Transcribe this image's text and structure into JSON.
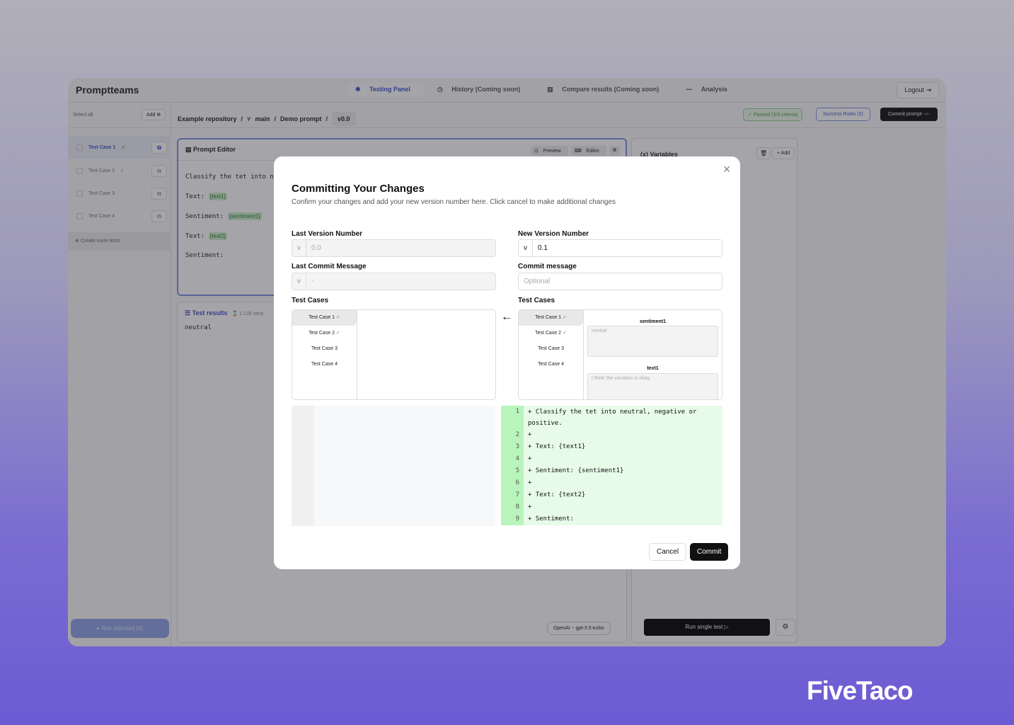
{
  "app": {
    "brand": "Promptteams",
    "nav": [
      "Testing Panel",
      "History (Coming soon)",
      "Compare results (Coming soon)",
      "Analysis"
    ],
    "logout": "Logout"
  },
  "sidebar": {
    "select_all": "Select all",
    "add": "Add",
    "cases": [
      "Test Case 1",
      "Test Case 2",
      "Test Case 3",
      "Test Case 4"
    ],
    "create": "Create more tests",
    "run_selected": "Run selected (0)"
  },
  "breadcrumb": {
    "repo": "Example repository",
    "branch": "main",
    "prompt": "Demo prompt",
    "version": "v0.0"
  },
  "status": {
    "passed": "Passed (3/3 criteria)",
    "rules": "Success Rules (3)",
    "commit": "Commit prompt"
  },
  "editor": {
    "title": "Prompt Editor",
    "preview": "Preview",
    "editor": "Editor",
    "lines": [
      "Classify the tet into ne",
      "Text:",
      "Sentiment:",
      "Text:",
      "Sentiment:"
    ],
    "vars": [
      "{text1}",
      "{sentiment1}",
      "{text2}"
    ]
  },
  "results": {
    "title": "Test results",
    "time": "1.139 seco",
    "output": "neutral",
    "model": "OpenAI ~ gpt-3.5-turbo"
  },
  "variables": {
    "title": "Variables",
    "add": "+ Add",
    "run_single": "Run single test"
  },
  "modal": {
    "title": "Committing Your Changes",
    "desc": "Confirm your changes and add your new version number here. Click cancel to make additional changes",
    "last_version_label": "Last Version Number",
    "last_version": "0.0",
    "new_version_label": "New Version Number",
    "new_version": "0.1",
    "prefix": "v",
    "last_msg_label": "Last Commit Message",
    "last_msg": "-",
    "msg_label": "Commit message",
    "msg_placeholder": "Optional",
    "tc_label": "Test Cases",
    "cases": [
      "Test Case 1",
      "Test Case 2",
      "Test Case 3",
      "Test Case 4"
    ],
    "var1_name": "sentiment1",
    "var1_val": "neutral",
    "var2_name": "text1",
    "var2_val": "I think the vacation is okay.",
    "diff": [
      {
        "n": "1",
        "c": "+ Classify the tet into neutral, negative or positive."
      },
      {
        "n": "2",
        "c": "+"
      },
      {
        "n": "3",
        "c": "+ Text: {text1}"
      },
      {
        "n": "4",
        "c": "+"
      },
      {
        "n": "5",
        "c": "+ Sentiment: {sentiment1}"
      },
      {
        "n": "6",
        "c": "+"
      },
      {
        "n": "7",
        "c": "+ Text: {text2}"
      },
      {
        "n": "8",
        "c": "+"
      },
      {
        "n": "9",
        "c": "+ Sentiment:"
      }
    ],
    "cancel": "Cancel",
    "commit": "Commit"
  },
  "watermark": "FiveTaco"
}
